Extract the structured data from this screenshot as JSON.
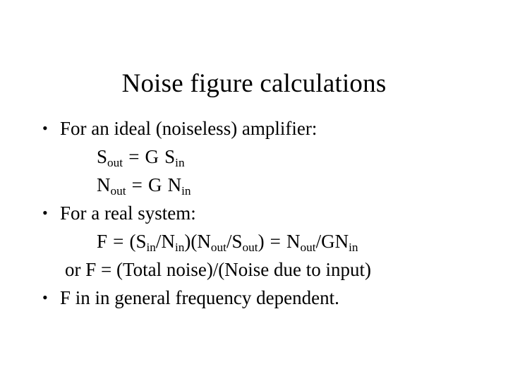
{
  "slide": {
    "title": "Noise figure calculations",
    "background_color": "#ffffff",
    "text_color": "#000000",
    "bullet_glyph": "•",
    "content": [
      {
        "kind": "bullet",
        "text": "For an ideal (noiseless) amplifier:"
      },
      {
        "kind": "equation",
        "text": "Sout = G Sin",
        "parts": {
          "lhs_base": "S",
          "lhs_sub": "out",
          "operator": "=",
          "gain": "G",
          "rhs_base": "S",
          "rhs_sub": "in"
        }
      },
      {
        "kind": "equation",
        "text": "Nout = G Nin",
        "parts": {
          "lhs_base": "N",
          "lhs_sub": "out",
          "operator": "=",
          "gain": "G",
          "rhs_base": "N",
          "rhs_sub": "in"
        }
      },
      {
        "kind": "bullet",
        "text": "For a real system:"
      },
      {
        "kind": "equation",
        "text": "F = (Sin/Nin)(Nout/Sout) = Nout/GNin",
        "parts": {
          "f": "F",
          "eq1": "=",
          "open1": "(",
          "s_in_base": "S",
          "s_in_sub": "in",
          "slash1": "/",
          "n_in_base": "N",
          "n_in_sub": "in",
          "close1": ")",
          "open2": "(",
          "n_out_base": "N",
          "n_out_sub": "out",
          "slash2": "/",
          "s_out_base": "S",
          "s_out_sub": "out",
          "close2": ")",
          "eq2": "=",
          "res_n_base": "N",
          "res_n_sub": "out",
          "slash3": "/",
          "res_gn": "GN",
          "res_gn_sub": "in"
        }
      },
      {
        "kind": "text",
        "text": "or  F = (Total noise)/(Noise due to input)"
      },
      {
        "kind": "bullet",
        "text": "F in in general frequency dependent."
      }
    ]
  }
}
